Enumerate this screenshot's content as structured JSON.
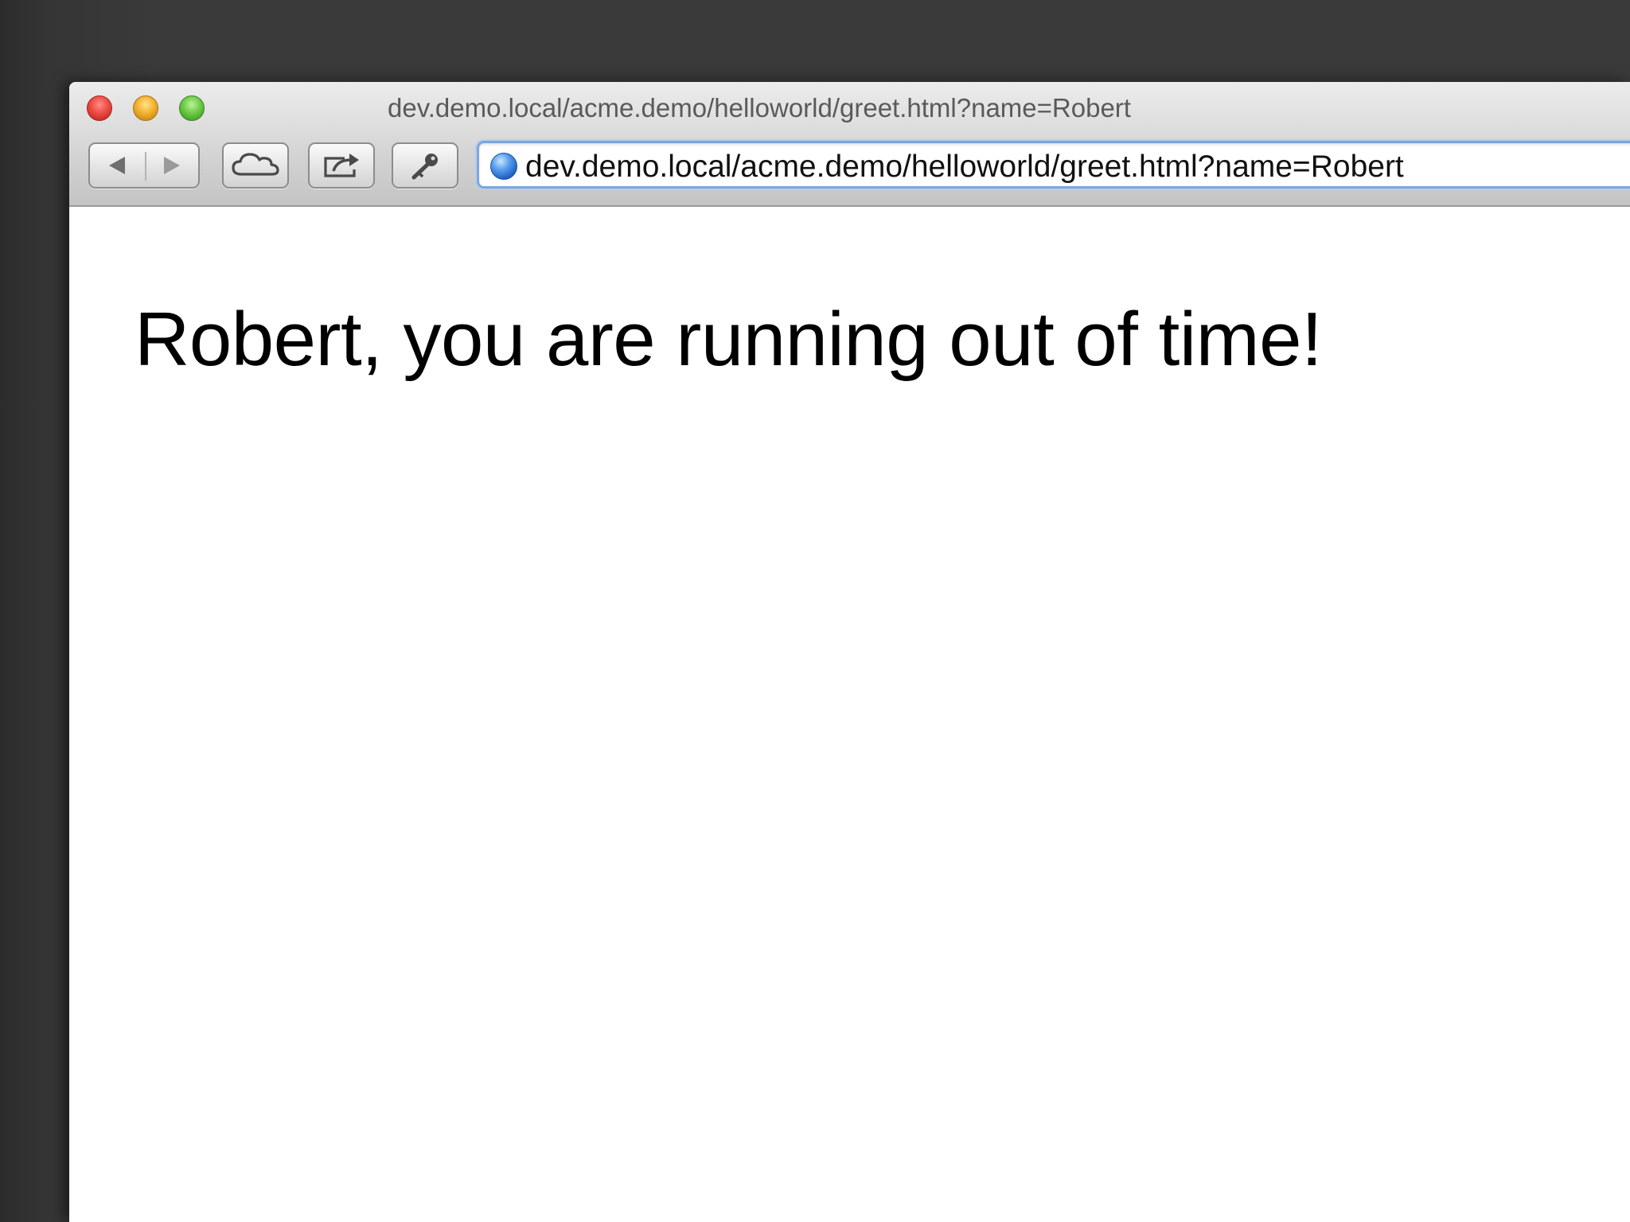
{
  "browser": {
    "window_title": "dev.demo.local/acme.demo/helloworld/greet.html?name=Robert",
    "address_bar": {
      "url": "dev.demo.local/acme.demo/helloworld/greet.html?name=Robert",
      "icon": "globe-icon"
    },
    "toolbar": {
      "buttons": [
        {
          "icon": "back-arrow-icon"
        },
        {
          "icon": "forward-arrow-icon"
        },
        {
          "icon": "cloud-icon"
        },
        {
          "icon": "share-icon"
        },
        {
          "icon": "key-icon"
        }
      ]
    },
    "traffic_lights": {
      "close_color": "#ee4b43",
      "minimize_color": "#f3b22f",
      "zoom_color": "#6ccb45"
    }
  },
  "page": {
    "heading": "Robert, you are running out of time!"
  }
}
